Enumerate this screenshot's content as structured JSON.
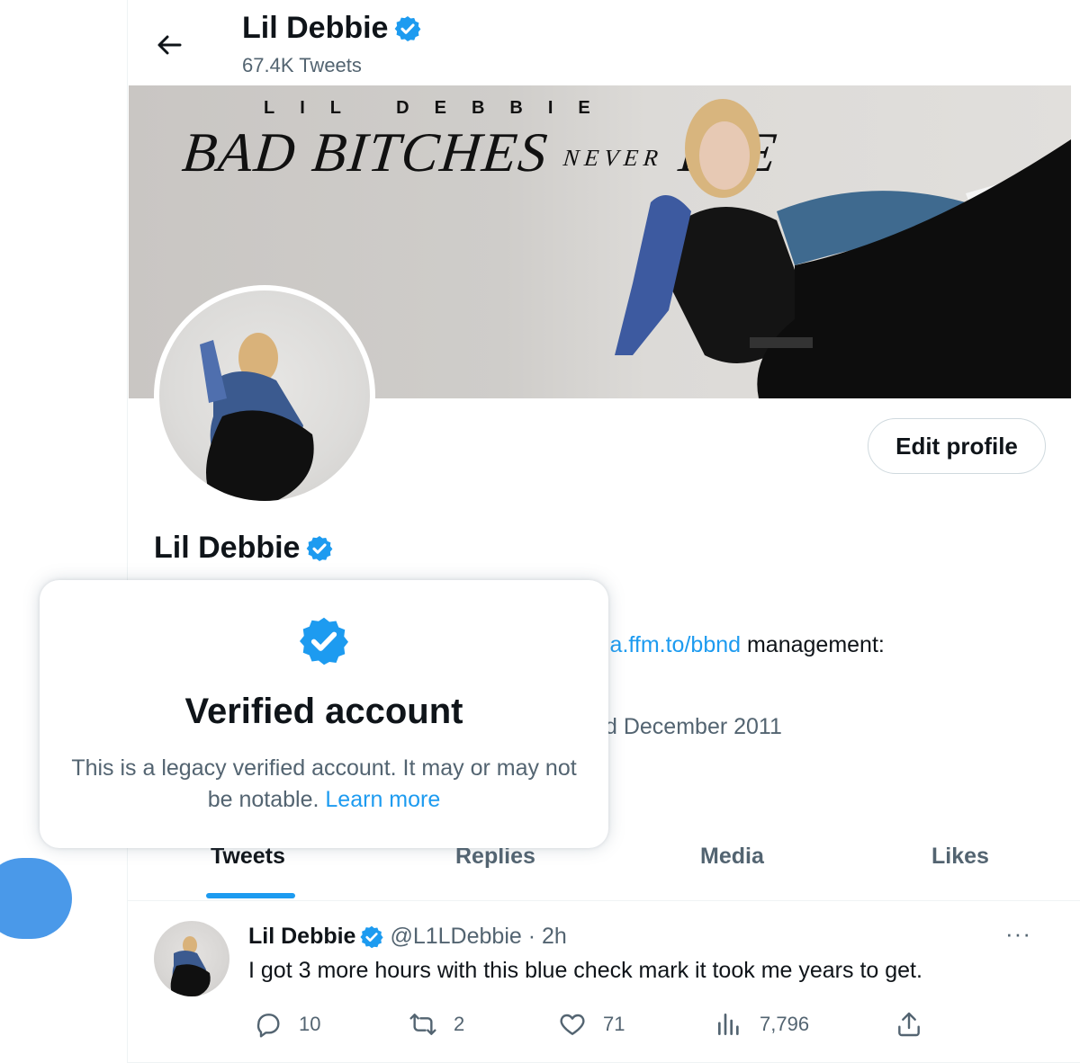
{
  "header": {
    "name": "Lil Debbie",
    "tweet_count": "67.4K Tweets"
  },
  "banner": {
    "line1": "LIL DEBBIE",
    "line2_a": "BAD BITCHES",
    "line2_b": "NEVER",
    "line2_c": "DIE"
  },
  "profile": {
    "edit_label": "Edit profile",
    "name": "Lil Debbie",
    "bio_link": "ia.ffm.to/bbnd",
    "bio_after_link": " management:",
    "joined": "d December 2011"
  },
  "tabs": [
    {
      "label": "Tweets"
    },
    {
      "label": "Replies"
    },
    {
      "label": "Media"
    },
    {
      "label": "Likes"
    }
  ],
  "tweet": {
    "name": "Lil Debbie",
    "handle": "@L1LDebbie · 2h",
    "text": "I got 3 more hours with this blue check mark it took me years to get.",
    "more": "···",
    "replies": "10",
    "retweets": "2",
    "likes": "71",
    "views": "7,796"
  },
  "popover": {
    "title": "Verified account",
    "desc": "This is a legacy verified account. It may or may not be notable.",
    "link": "Learn more"
  },
  "colors": {
    "accent": "#1d9bf0",
    "verified": "#1d9bf0",
    "muted_text": "#536471",
    "fab": "#4a99e9"
  },
  "icons": {
    "back": "arrow-left-icon",
    "verified": "verified-badge-icon",
    "reply": "reply-icon",
    "retweet": "retweet-icon",
    "like": "heart-icon",
    "views": "views-icon",
    "share": "share-icon"
  }
}
